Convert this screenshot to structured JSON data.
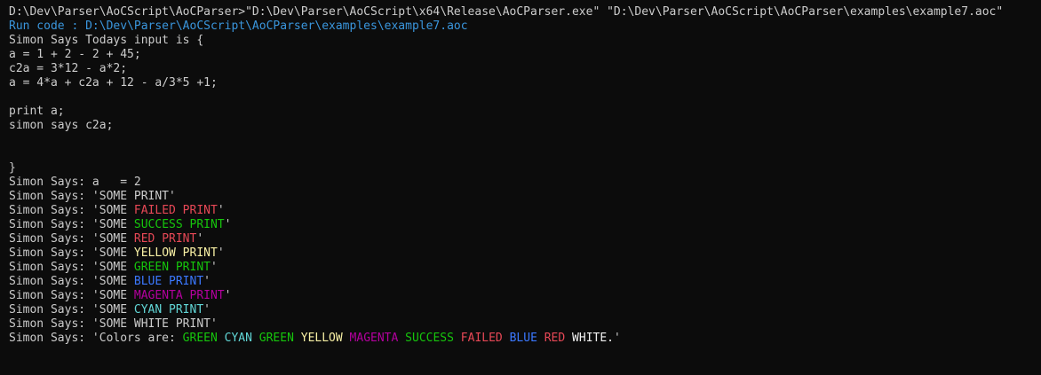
{
  "console": {
    "lines": [
      {
        "segments": [
          {
            "text": "D:\\Dev\\Parser\\AoCScript\\AoCParser>\"D:\\Dev\\Parser\\AoCScript\\x64\\Release\\AoCParser.exe\" \"D:\\Dev\\Parser\\AoCScript\\AoCParser\\examples\\example7.aoc\"",
            "color": "#cccccc"
          }
        ]
      },
      {
        "segments": [
          {
            "text": "Run code : D:\\Dev\\Parser\\AoCScript\\AoCParser\\examples\\example7.aoc",
            "color": "#3a96dd"
          }
        ]
      },
      {
        "segments": [
          {
            "text": "Simon Says Todays input is {",
            "color": "#cccccc"
          }
        ]
      },
      {
        "segments": [
          {
            "text": "a = 1 + 2 - 2 + 45;",
            "color": "#cccccc"
          }
        ]
      },
      {
        "segments": [
          {
            "text": "c2a = 3*12 - a*2;",
            "color": "#cccccc"
          }
        ]
      },
      {
        "segments": [
          {
            "text": "a = 4*a + c2a + 12 - a/3*5 +1;",
            "color": "#cccccc"
          }
        ]
      },
      {
        "segments": [
          {
            "text": "",
            "color": "#cccccc"
          }
        ]
      },
      {
        "segments": [
          {
            "text": "print a;",
            "color": "#cccccc"
          }
        ]
      },
      {
        "segments": [
          {
            "text": "simon says c2a;",
            "color": "#cccccc"
          }
        ]
      },
      {
        "segments": [
          {
            "text": "",
            "color": "#cccccc"
          }
        ]
      },
      {
        "segments": [
          {
            "text": "",
            "color": "#cccccc"
          }
        ]
      },
      {
        "segments": [
          {
            "text": "}",
            "color": "#cccccc"
          }
        ]
      },
      {
        "segments": [
          {
            "text": "Simon Says: a   = 2",
            "color": "#cccccc"
          }
        ]
      },
      {
        "segments": [
          {
            "text": "Simon Says: 'SOME PRINT'",
            "color": "#cccccc"
          }
        ]
      },
      {
        "segments": [
          {
            "text": "Simon Says: 'SOME ",
            "color": "#cccccc"
          },
          {
            "text": "FAILED PRINT",
            "color": "#e74856"
          },
          {
            "text": "'",
            "color": "#cccccc"
          }
        ]
      },
      {
        "segments": [
          {
            "text": "Simon Says: 'SOME ",
            "color": "#cccccc"
          },
          {
            "text": "SUCCESS PRINT",
            "color": "#16c60c"
          },
          {
            "text": "'",
            "color": "#cccccc"
          }
        ]
      },
      {
        "segments": [
          {
            "text": "Simon Says: 'SOME ",
            "color": "#cccccc"
          },
          {
            "text": "RED PRINT",
            "color": "#e74856"
          },
          {
            "text": "'",
            "color": "#cccccc"
          }
        ]
      },
      {
        "segments": [
          {
            "text": "Simon Says: 'SOME ",
            "color": "#cccccc"
          },
          {
            "text": "YELLOW PRINT",
            "color": "#f9f1a5"
          },
          {
            "text": "'",
            "color": "#cccccc"
          }
        ]
      },
      {
        "segments": [
          {
            "text": "Simon Says: 'SOME ",
            "color": "#cccccc"
          },
          {
            "text": "GREEN PRINT",
            "color": "#16c60c"
          },
          {
            "text": "'",
            "color": "#cccccc"
          }
        ]
      },
      {
        "segments": [
          {
            "text": "Simon Says: 'SOME ",
            "color": "#cccccc"
          },
          {
            "text": "BLUE PRINT",
            "color": "#3b78ff"
          },
          {
            "text": "'",
            "color": "#cccccc"
          }
        ]
      },
      {
        "segments": [
          {
            "text": "Simon Says: 'SOME ",
            "color": "#cccccc"
          },
          {
            "text": "MAGENTA PRINT",
            "color": "#b4009e"
          },
          {
            "text": "'",
            "color": "#cccccc"
          }
        ]
      },
      {
        "segments": [
          {
            "text": "Simon Says: 'SOME ",
            "color": "#cccccc"
          },
          {
            "text": "CYAN PRINT",
            "color": "#61d6d6"
          },
          {
            "text": "'",
            "color": "#cccccc"
          }
        ]
      },
      {
        "segments": [
          {
            "text": "Simon Says: 'SOME WHITE PRINT'",
            "color": "#cccccc"
          }
        ]
      },
      {
        "segments": [
          {
            "text": "Simon Says: 'Colors are: ",
            "color": "#cccccc"
          },
          {
            "text": "GREEN",
            "color": "#16c60c"
          },
          {
            "text": " ",
            "color": "#cccccc"
          },
          {
            "text": "CYAN",
            "color": "#61d6d6"
          },
          {
            "text": " ",
            "color": "#cccccc"
          },
          {
            "text": "GREEN",
            "color": "#16c60c"
          },
          {
            "text": " ",
            "color": "#cccccc"
          },
          {
            "text": "YELLOW",
            "color": "#f9f1a5"
          },
          {
            "text": " ",
            "color": "#cccccc"
          },
          {
            "text": "MAGENTA",
            "color": "#b4009e"
          },
          {
            "text": " ",
            "color": "#cccccc"
          },
          {
            "text": "SUCCESS",
            "color": "#16c60c"
          },
          {
            "text": " ",
            "color": "#cccccc"
          },
          {
            "text": "FAILED",
            "color": "#e74856"
          },
          {
            "text": " ",
            "color": "#cccccc"
          },
          {
            "text": "BLUE",
            "color": "#3b78ff"
          },
          {
            "text": " ",
            "color": "#cccccc"
          },
          {
            "text": "RED",
            "color": "#e74856"
          },
          {
            "text": " ",
            "color": "#cccccc"
          },
          {
            "text": "WHITE.",
            "color": "#f2f2f2"
          },
          {
            "text": "'",
            "color": "#cccccc"
          }
        ]
      }
    ]
  }
}
